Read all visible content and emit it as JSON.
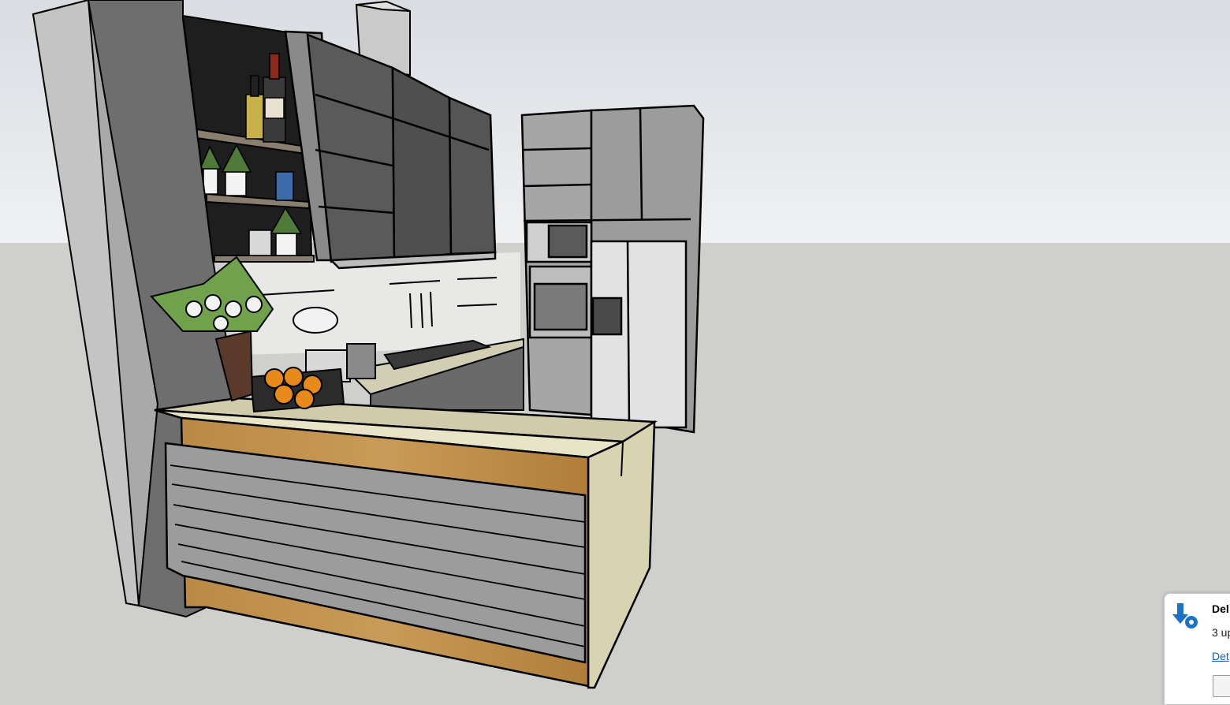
{
  "viewport": {
    "scene": "kitchen-3d-model",
    "sky_color": "#dde1e6",
    "ground_color": "#cfd0cc"
  },
  "notification": {
    "icon": "download-gear-icon",
    "title": "Del",
    "body": "3 up",
    "link": "Det",
    "accent_color": "#1a73c8"
  }
}
